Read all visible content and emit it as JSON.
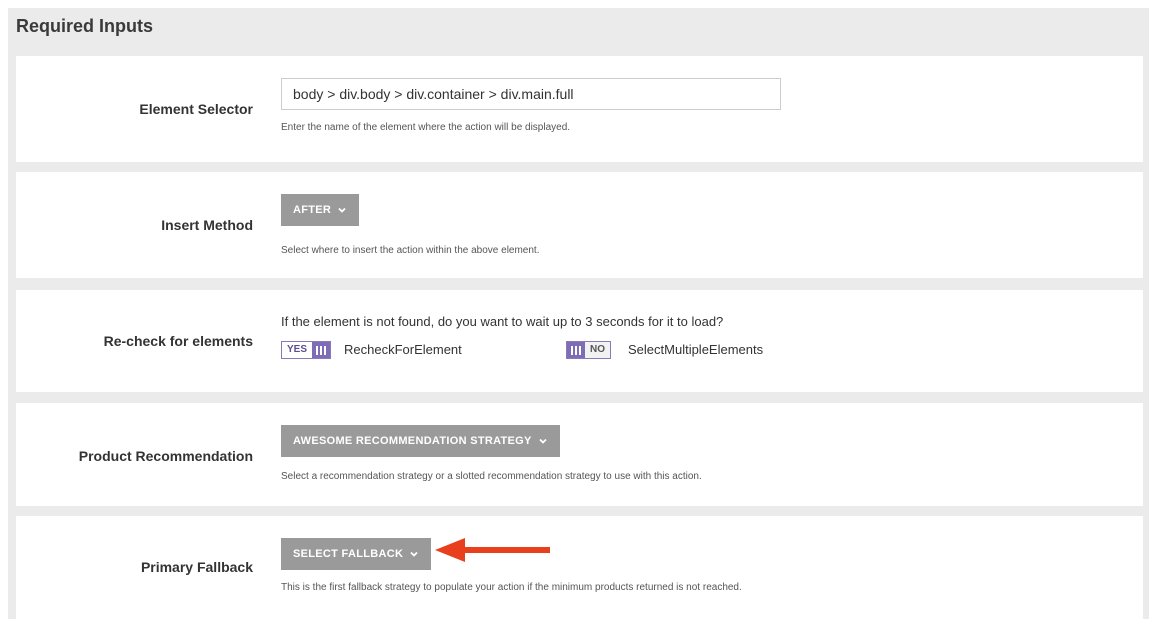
{
  "panel": {
    "title": "Required Inputs"
  },
  "element_selector": {
    "label": "Element Selector",
    "value": "body > div.body > div.container > div.main.full",
    "help": "Enter the name of the element where the action will be displayed."
  },
  "insert_method": {
    "label": "Insert Method",
    "button": "AFTER",
    "help": "Select where to insert the action within the above element."
  },
  "recheck": {
    "label": "Re-check for elements",
    "question": "If the element is not found, do you want to wait up to 3 seconds for it to load?",
    "toggle1": {
      "text": "YES",
      "name": "RecheckForElement",
      "on": true
    },
    "toggle2": {
      "text": "NO",
      "name": "SelectMultipleElements",
      "on": false
    }
  },
  "product_recommendation": {
    "label": "Product Recommendation",
    "button": "AWESOME RECOMMENDATION STRATEGY",
    "help": "Select a recommendation strategy or a slotted recommendation strategy to use with this action."
  },
  "primary_fallback": {
    "label": "Primary Fallback",
    "button": "SELECT FALLBACK",
    "help": "This is the first fallback strategy to populate your action if the minimum products returned is not reached."
  },
  "colors": {
    "accent_purple": "#7e6cb5",
    "button_gray": "#9a9a9a",
    "arrow_red": "#e8401c"
  },
  "icons": {
    "dropdown": "chevron-down-icon",
    "toggle_grip": "grip-icon",
    "annotation": "arrow-left-icon"
  }
}
